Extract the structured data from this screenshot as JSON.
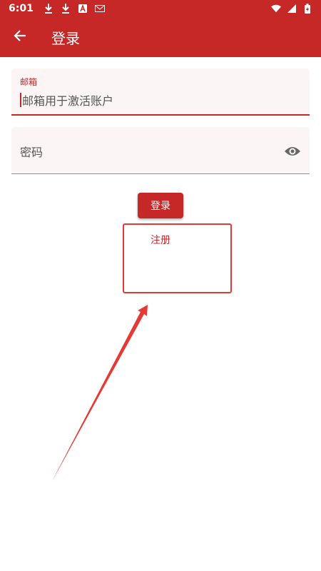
{
  "status_bar": {
    "time": "6:01",
    "left_icons": [
      "download-icon",
      "download-icon",
      "font-app-icon",
      "mail-icon"
    ],
    "right_icons": [
      "wifi-icon",
      "signal-icon",
      "battery-icon"
    ]
  },
  "app_bar": {
    "back_icon": "arrow-back-icon",
    "title": "登录"
  },
  "form": {
    "email": {
      "label": "邮箱",
      "value": "邮箱用于激活账户"
    },
    "password": {
      "placeholder": "密码",
      "toggle_icon": "eye-icon"
    },
    "login_label": "登录",
    "register_label": "注册"
  },
  "colors": {
    "primary": "#c62828",
    "annotation": "#e53935",
    "field_bg": "#fbf5f5"
  }
}
